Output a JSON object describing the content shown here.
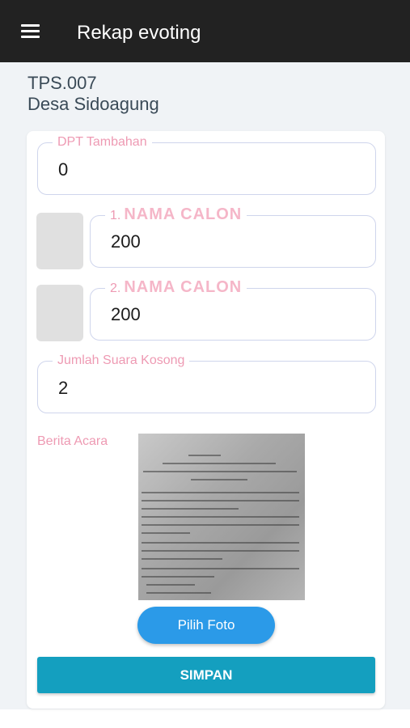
{
  "appbar": {
    "title": "Rekap evoting",
    "menu_icon": "menu-icon"
  },
  "location": {
    "tps": "TPS.007",
    "desa": "Desa Sidoagung"
  },
  "form": {
    "dpt_tambahan": {
      "label": "DPT Tambahan",
      "value": "0"
    },
    "candidates": [
      {
        "number": "1.",
        "name": "NAMA CALON",
        "value": "200"
      },
      {
        "number": "2.",
        "name": "NAMA CALON",
        "value": "200"
      }
    ],
    "suara_kosong": {
      "label": "Jumlah Suara Kosong",
      "value": "2"
    },
    "berita_acara": {
      "label": "Berita Acara"
    },
    "pilih_foto_label": "Pilih Foto",
    "simpan_label": "SIMPAN"
  },
  "colors": {
    "appbar": "#222222",
    "label_pink": "#ee9ab3",
    "foto_button": "#2b9ae8",
    "simpan_button": "#149fbf"
  }
}
